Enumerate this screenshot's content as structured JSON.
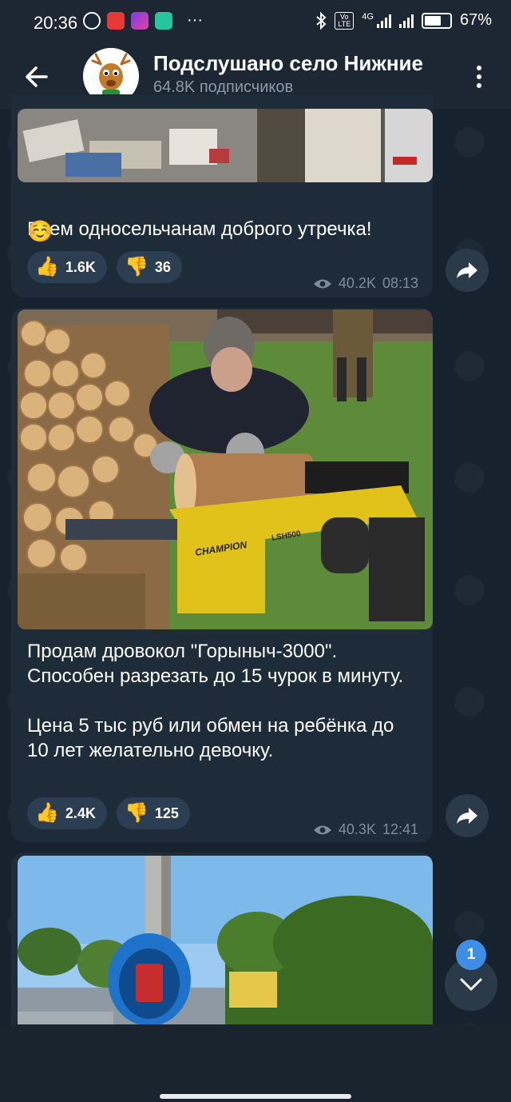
{
  "status_bar": {
    "time": "20:36",
    "network": "4G",
    "volte": "Vo LTE",
    "battery": "67%",
    "more": "···"
  },
  "header": {
    "title": "Подслушано село Нижние",
    "subtitle": "64.8K подписчиков"
  },
  "posts": [
    {
      "text": "Всем односельчанам доброго утречка!",
      "emoji": "☺️",
      "reactions": [
        {
          "emoji": "👍",
          "count": "1.6K"
        },
        {
          "emoji": "👎",
          "count": "36"
        }
      ],
      "views": "40.2K",
      "time": "08:13"
    },
    {
      "text": "Продам дровокол \"Горыныч-3000\".\nСпособен разрезать до 15 чурок в минуту.\n\nЦена 5 тыс руб или обмен на ребёнка до 10 лет желательно девочку.",
      "machine_brand": "CHAMPION",
      "machine_model": "LSH500",
      "reactions": [
        {
          "emoji": "👍",
          "count": "2.4K"
        },
        {
          "emoji": "👎",
          "count": "125"
        }
      ],
      "views": "40.3K",
      "time": "12:41"
    }
  ],
  "unread_badge": "1",
  "colors": {
    "background": "#16222e",
    "bubble": "#1e2c3a",
    "header": "#1d2733",
    "reaction": "#2b3e52",
    "badge": "#3e8ee6",
    "meta": "#7f8c99"
  }
}
